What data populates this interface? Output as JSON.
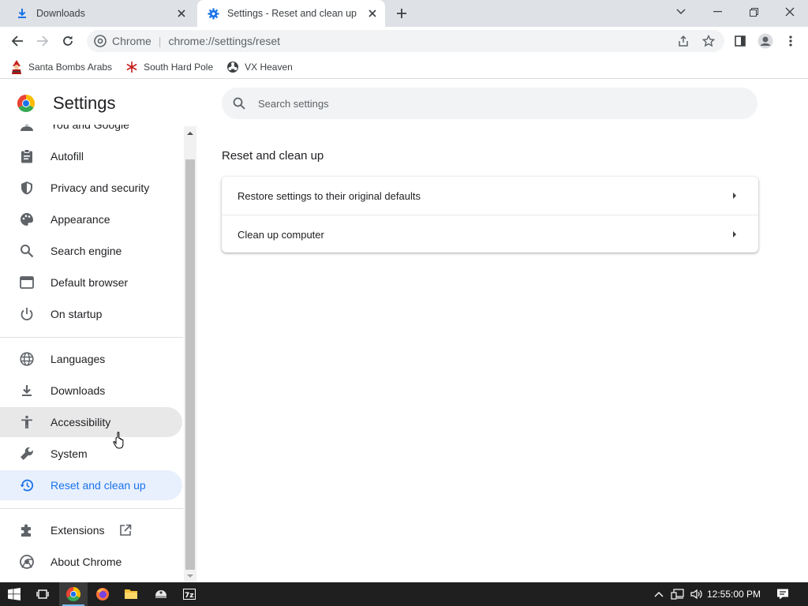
{
  "tabs": [
    {
      "title": "Downloads",
      "icon": "download-icon",
      "active": false
    },
    {
      "title": "Settings - Reset and clean up",
      "icon": "gear-icon",
      "active": true
    }
  ],
  "omnibox": {
    "origin": "Chrome",
    "separator": "|",
    "url": "chrome://settings/reset"
  },
  "bookmarks": [
    {
      "label": "Santa Bombs Arabs",
      "icon": "santa-icon"
    },
    {
      "label": "South Hard Pole",
      "icon": "snowflake-icon"
    },
    {
      "label": "VX Heaven",
      "icon": "biohazard-icon"
    }
  ],
  "settings": {
    "title": "Settings",
    "search_placeholder": "Search settings"
  },
  "sidebar": {
    "items": [
      {
        "label": "You and Google",
        "icon": "person-icon"
      },
      {
        "label": "Autofill",
        "icon": "clipboard-icon"
      },
      {
        "label": "Privacy and security",
        "icon": "shield-icon"
      },
      {
        "label": "Appearance",
        "icon": "palette-icon"
      },
      {
        "label": "Search engine",
        "icon": "search-icon"
      },
      {
        "label": "Default browser",
        "icon": "browser-window-icon"
      },
      {
        "label": "On startup",
        "icon": "power-icon"
      },
      {
        "label": "Languages",
        "icon": "globe-icon"
      },
      {
        "label": "Downloads",
        "icon": "download-icon"
      },
      {
        "label": "Accessibility",
        "icon": "accessibility-icon"
      },
      {
        "label": "System",
        "icon": "wrench-icon"
      },
      {
        "label": "Reset and clean up",
        "icon": "history-icon"
      },
      {
        "label": "Extensions",
        "icon": "puzzle-icon"
      },
      {
        "label": "About Chrome",
        "icon": "chrome-logo-icon"
      }
    ],
    "selected": "Reset and clean up",
    "hovered": "Accessibility"
  },
  "main": {
    "section_title": "Reset and clean up",
    "rows": [
      {
        "label": "Restore settings to their original defaults"
      },
      {
        "label": "Clean up computer"
      }
    ]
  },
  "taskbar": {
    "clock": "12:55:00 PM",
    "apps": [
      "start-icon",
      "task-view-icon",
      "chrome-icon",
      "firefox-icon",
      "file-explorer-icon",
      "app-icon",
      "7zip-icon"
    ]
  },
  "colors": {
    "accent": "#1a73e8",
    "selected_bg": "#e8f0fe",
    "tabstrip_bg": "#dee1e6",
    "taskbar_bg": "#1f1f1f"
  }
}
